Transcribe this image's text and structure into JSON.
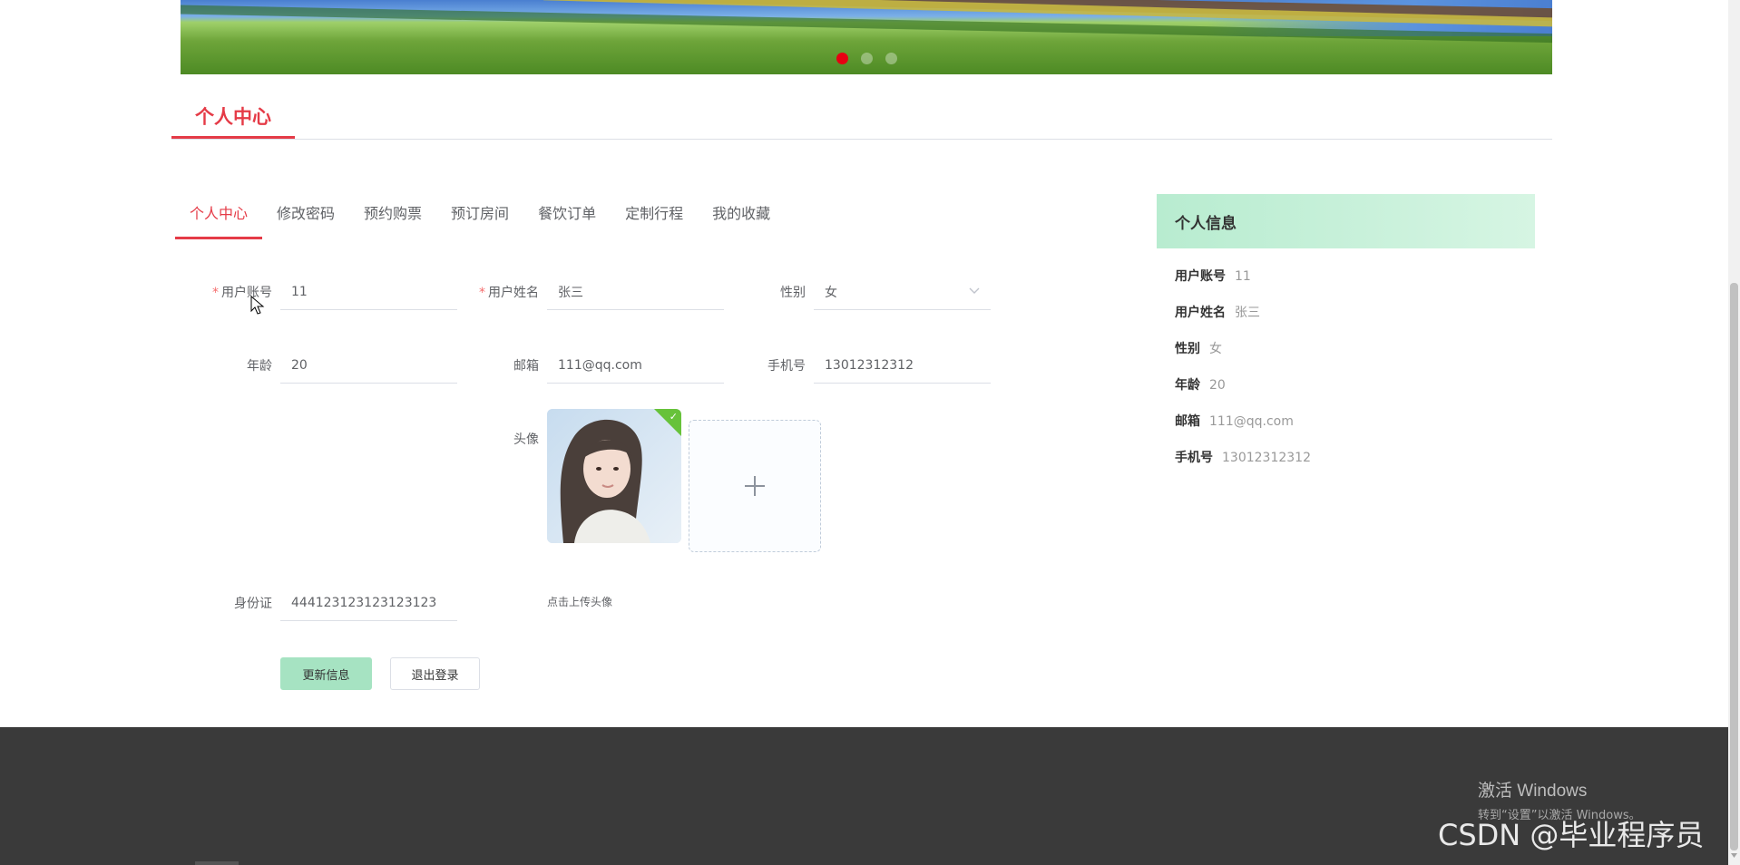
{
  "banner": {
    "slide_count": 3,
    "active_slide": 1
  },
  "page": {
    "title": "个人中心"
  },
  "tabs": [
    {
      "label": "个人中心",
      "active": true
    },
    {
      "label": "修改密码",
      "active": false
    },
    {
      "label": "预约购票",
      "active": false
    },
    {
      "label": "预订房间",
      "active": false
    },
    {
      "label": "餐饮订单",
      "active": false
    },
    {
      "label": "定制行程",
      "active": false
    },
    {
      "label": "我的收藏",
      "active": false
    }
  ],
  "form": {
    "account": {
      "label": "用户账号",
      "value": "11",
      "required": true
    },
    "name": {
      "label": "用户姓名",
      "value": "张三",
      "required": true
    },
    "gender": {
      "label": "性别",
      "value": "女"
    },
    "age": {
      "label": "年龄",
      "value": "20"
    },
    "email": {
      "label": "邮箱",
      "value": "111@qq.com"
    },
    "phone": {
      "label": "手机号",
      "value": "13012312312"
    },
    "avatar": {
      "label": "头像",
      "upload_tip": "点击上传头像"
    },
    "idcard": {
      "label": "身份证",
      "value": "444123123123123123"
    },
    "required_mark": "*"
  },
  "buttons": {
    "update": "更新信息",
    "logout": "退出登录"
  },
  "info_panel": {
    "title": "个人信息",
    "rows": [
      {
        "key": "用户账号",
        "value": "11"
      },
      {
        "key": "用户姓名",
        "value": "张三"
      },
      {
        "key": "性别",
        "value": "女"
      },
      {
        "key": "年龄",
        "value": "20"
      },
      {
        "key": "邮箱",
        "value": "111@qq.com"
      },
      {
        "key": "手机号",
        "value": "13012312312"
      }
    ]
  },
  "overlay": {
    "windows_title": "激活 Windows",
    "windows_sub": "转到“设置”以激活 Windows。",
    "csdn": "CSDN @毕业程序员"
  },
  "colors": {
    "accent": "#e53b47",
    "update_button": "#a6e3c2",
    "footer": "#3a3a3a",
    "banner_active_dot": "#e60012"
  },
  "icons": {
    "upload": "plus-icon",
    "gender_select": "chevron-down-icon",
    "avatar_status": "check-icon"
  }
}
